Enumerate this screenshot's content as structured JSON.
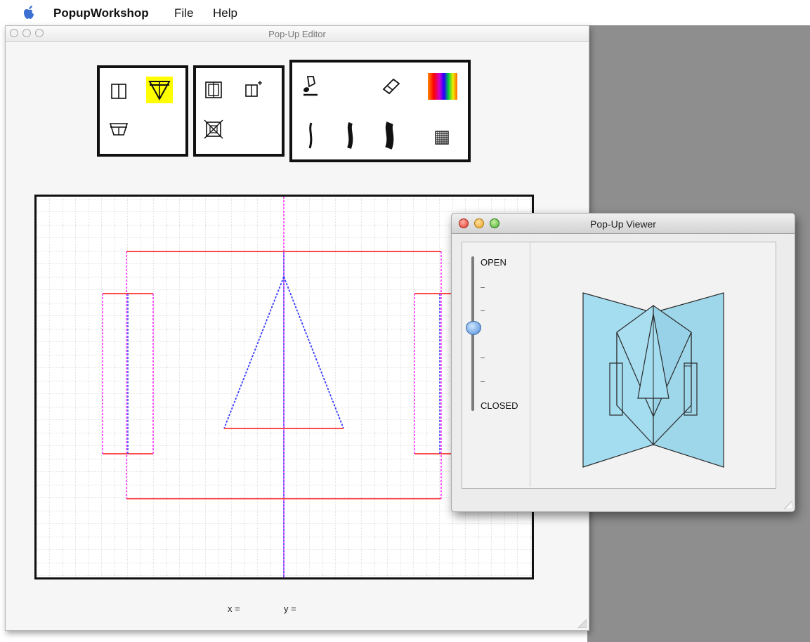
{
  "menubar": {
    "app_name": "PopupWorkshop",
    "items": [
      "File",
      "Help"
    ]
  },
  "editor": {
    "title": "Pop-Up Editor",
    "coords": {
      "x_label": "x =",
      "y_label": "y ="
    },
    "palette_groups": [
      {
        "name": "fold-types",
        "tools": [
          "parallel-fold-icon",
          "v-fold-icon",
          "trapezoid-fold-icon"
        ],
        "selected": "v-fold-icon"
      },
      {
        "name": "structure-tools",
        "tools": [
          "box-fold-icon",
          "add-fold-icon",
          "delete-fold-icon"
        ]
      },
      {
        "name": "drawing-tools",
        "tools": [
          "paint-brush-icon",
          "eraser-icon",
          "color-spectrum-icon",
          "thin-line-icon",
          "medium-line-icon",
          "thick-line-icon",
          "grid-icon"
        ]
      }
    ],
    "colors": {
      "selected_highlight": "#ffff00",
      "cut_line": "#ff4a4a",
      "fold_line_blue": "#3a3aff",
      "fold_line_magenta": "#ff2aff",
      "grid": "#c8c8c8"
    }
  },
  "viewer": {
    "title": "Pop-Up Viewer",
    "slider": {
      "open_label": "OPEN",
      "closed_label": "CLOSED",
      "value": 0.52
    },
    "colors": {
      "paper": "#a4dcf0",
      "paper_edge": "#2a2a2a"
    }
  }
}
